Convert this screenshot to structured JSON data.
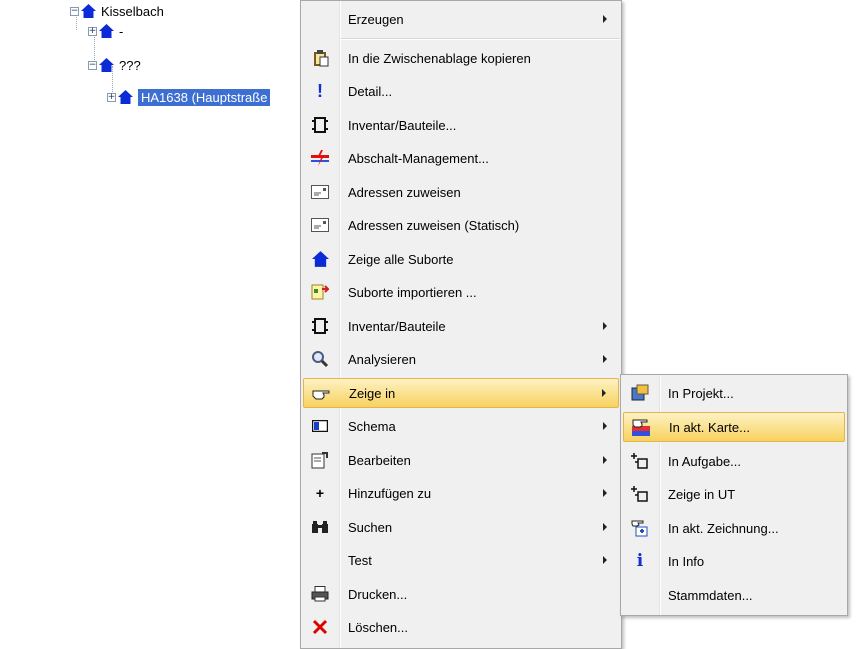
{
  "tree": {
    "nodes": [
      {
        "label": "Kisselbach",
        "expander": "−"
      },
      {
        "label": "-",
        "expander": "+"
      },
      {
        "label": "???",
        "expander": "−"
      },
      {
        "label": "HA1638 (Hauptstraße",
        "expander": "+"
      }
    ]
  },
  "context_menu": {
    "items": [
      {
        "label": "Erzeugen",
        "icon": "none",
        "submenu": true
      },
      {
        "label": "In die Zwischenablage kopieren",
        "icon": "clipboard-icon"
      },
      {
        "label": "Detail...",
        "icon": "exclamation-icon"
      },
      {
        "label": "Inventar/Bauteile...",
        "icon": "component-icon"
      },
      {
        "label": "Abschalt-Management...",
        "icon": "shutdown-icon"
      },
      {
        "label": "Adressen zuweisen",
        "icon": "address-card-icon"
      },
      {
        "label": "Adressen zuweisen (Statisch)",
        "icon": "address-card-icon"
      },
      {
        "label": "Zeige alle Suborte",
        "icon": "house-icon"
      },
      {
        "label": "Suborte importieren ...",
        "icon": "import-icon"
      },
      {
        "label": "Inventar/Bauteile",
        "icon": "component-icon",
        "submenu": true
      },
      {
        "label": "Analysieren",
        "icon": "magnifier-icon",
        "submenu": true
      },
      {
        "label": "Zeige in",
        "icon": "pointing-hand-icon",
        "submenu": true,
        "highlighted": true
      },
      {
        "label": "Schema",
        "icon": "schema-icon",
        "submenu": true
      },
      {
        "label": "Bearbeiten",
        "icon": "edit-icon",
        "submenu": true
      },
      {
        "label": "Hinzufügen zu",
        "icon": "plus-icon",
        "submenu": true
      },
      {
        "label": "Suchen",
        "icon": "binoculars-icon",
        "submenu": true
      },
      {
        "label": "Test",
        "icon": "none",
        "submenu": true
      },
      {
        "label": "Drucken...",
        "icon": "printer-icon"
      },
      {
        "label": "Löschen...",
        "icon": "delete-x-icon"
      }
    ]
  },
  "submenu": {
    "items": [
      {
        "label": "In Projekt...",
        "icon": "project-icon"
      },
      {
        "label": "In akt. Karte...",
        "icon": "map-hand-icon",
        "highlighted": true
      },
      {
        "label": "In Aufgabe...",
        "icon": "task-icon"
      },
      {
        "label": "Zeige in UT",
        "icon": "task-icon"
      },
      {
        "label": "In akt. Zeichnung...",
        "icon": "drawing-icon"
      },
      {
        "label": "In Info",
        "icon": "info-icon"
      },
      {
        "label": "Stammdaten...",
        "icon": "none"
      }
    ]
  },
  "colors": {
    "selection": "#3c6fd1",
    "highlight": "#f8d25f",
    "house": "#0a2bd6",
    "delete": "#e00000"
  }
}
